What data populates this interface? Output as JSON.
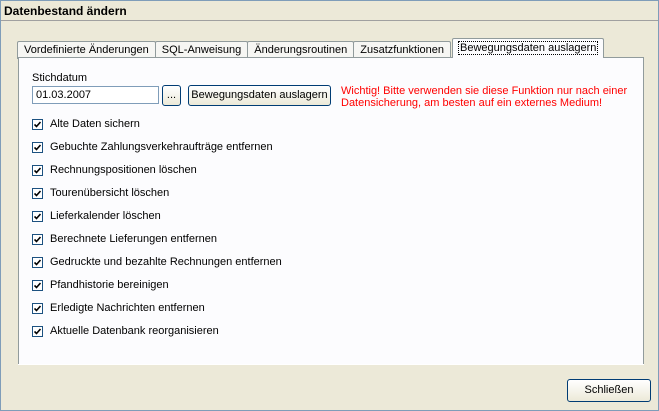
{
  "window": {
    "title": "Datenbestand ändern"
  },
  "tabs": [
    {
      "label": "Vordefinierte Änderungen",
      "active": false
    },
    {
      "label": "SQL-Anweisung",
      "active": false
    },
    {
      "label": "Änderungsroutinen",
      "active": false
    },
    {
      "label": "Zusatzfunktionen",
      "active": false
    },
    {
      "label": "Bewegungsdaten auslagern",
      "active": true
    }
  ],
  "form": {
    "stichdatum_label": "Stichdatum",
    "stichdatum_value": "01.03.2007",
    "browse_label": "...",
    "auslagern_label": "Bewegungsdaten auslagern",
    "warning": "Wichtig! Bitte verwenden sie diese Funktion nur nach einer Datensicherung, am besten auf ein externes Medium!",
    "warning_color": "#ff0000"
  },
  "options": [
    {
      "label": "Alte Daten sichern",
      "checked": true
    },
    {
      "label": "Gebuchte Zahlungsverkehraufträge entfernen",
      "checked": true
    },
    {
      "label": "Rechnungspositionen löschen",
      "checked": true
    },
    {
      "label": "Tourenübersicht löschen",
      "checked": true
    },
    {
      "label": "Lieferkalender löschen",
      "checked": true
    },
    {
      "label": "Berechnete Lieferungen entfernen",
      "checked": true
    },
    {
      "label": "Gedruckte und bezahlte Rechnungen entfernen",
      "checked": true
    },
    {
      "label": "Pfandhistorie bereinigen",
      "checked": true
    },
    {
      "label": "Erledigte Nachrichten entfernen",
      "checked": true
    },
    {
      "label": "Aktuelle Datenbank reorganisieren",
      "checked": true
    }
  ],
  "footer": {
    "close_label": "Schließen"
  }
}
